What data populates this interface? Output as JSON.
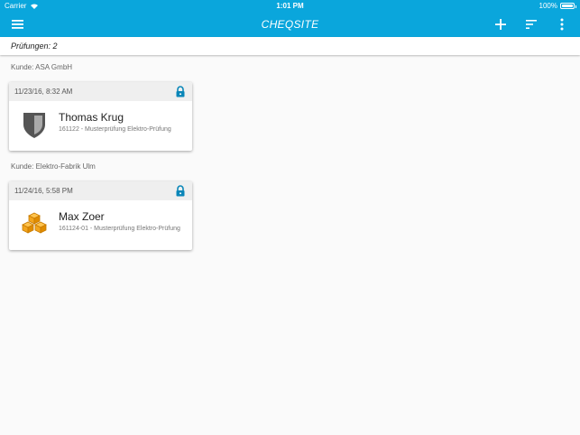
{
  "statusbar": {
    "carrier": "Carrier",
    "time": "1:01 PM",
    "battery": "100%"
  },
  "appbar": {
    "title": "CHEQSITE",
    "color": "#0aa6dc"
  },
  "subheader": {
    "count_label": "Prüfungen: 2"
  },
  "groups": [
    {
      "label": "Kunde: ASA GmbH",
      "card": {
        "date": "11/23/16, 8:32 AM",
        "name": "Thomas Krug",
        "desc": "161122 - Musterprüfung Elektro-Prüfung",
        "icon": "shield-icon",
        "locked": true
      }
    },
    {
      "label": "Kunde: Elektro-Fabrik Ulm",
      "card": {
        "date": "11/24/16, 5:58 PM",
        "name": "Max Zoer",
        "desc": "161124-01 - Musterprüfung Elektro-Prüfung",
        "icon": "boxes-icon",
        "locked": true
      }
    }
  ],
  "colors": {
    "lock": "#0a86b8",
    "boxes": "#f2a51e",
    "shield": "#555555"
  }
}
